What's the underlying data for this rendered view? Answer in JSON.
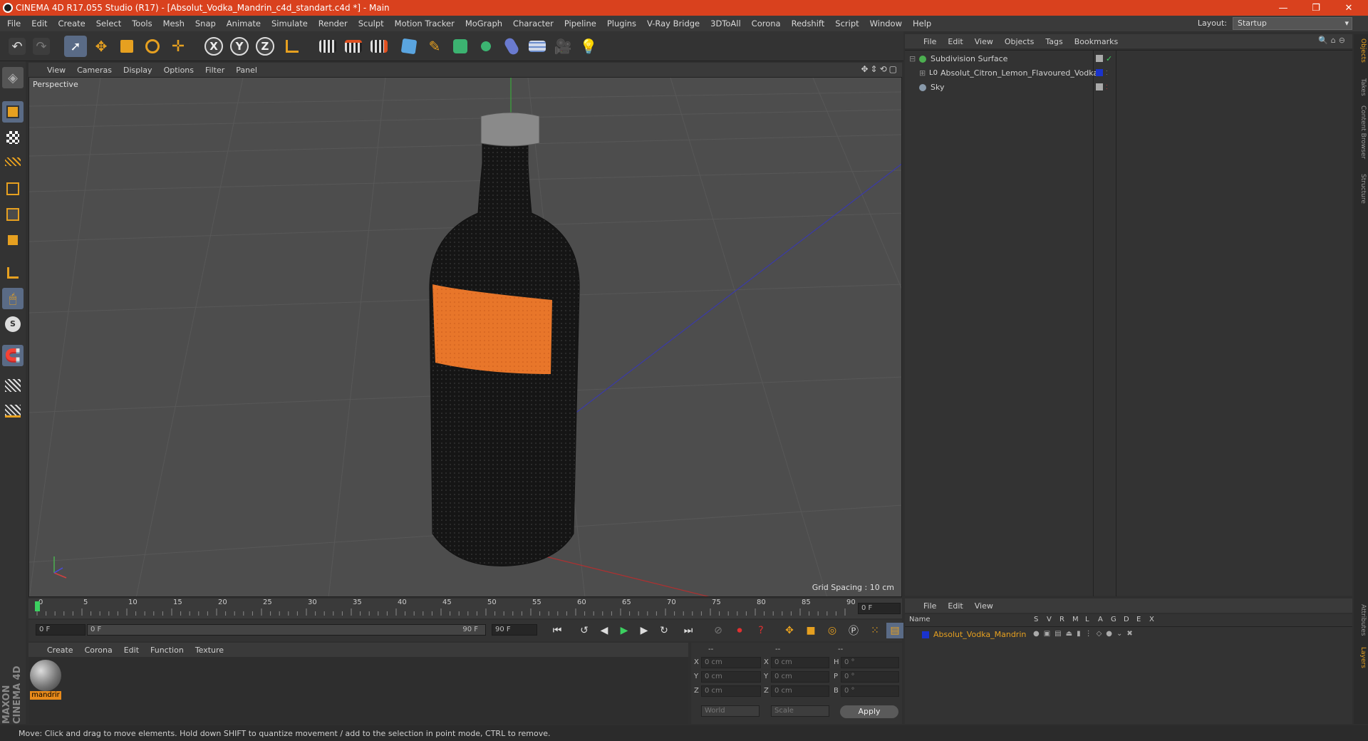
{
  "window": {
    "title": "CINEMA 4D R17.055 Studio (R17) - [Absolut_Vodka_Mandrin_c4d_standart.c4d *] - Main",
    "controls": {
      "minimize": "—",
      "restore": "❐",
      "close": "✕"
    }
  },
  "menubar": {
    "items": [
      "File",
      "Edit",
      "Create",
      "Select",
      "Tools",
      "Mesh",
      "Snap",
      "Animate",
      "Simulate",
      "Render",
      "Sculpt",
      "Motion Tracker",
      "MoGraph",
      "Character",
      "Pipeline",
      "Plugins",
      "V-Ray Bridge",
      "3DToAll",
      "Corona",
      "Redshift",
      "Script",
      "Window",
      "Help"
    ],
    "layout_label": "Layout:",
    "layout_value": "Startup"
  },
  "toolbar": {
    "axis_x": "X",
    "axis_y": "Y",
    "axis_z": "Z"
  },
  "viewport": {
    "menu": [
      "View",
      "Cameras",
      "Display",
      "Options",
      "Filter",
      "Panel"
    ],
    "label": "Perspective",
    "grid_spacing": "Grid Spacing : 10 cm"
  },
  "timeline": {
    "ticks": [
      "0",
      "5",
      "10",
      "15",
      "20",
      "25",
      "30",
      "35",
      "40",
      "45",
      "50",
      "55",
      "60",
      "65",
      "70",
      "75",
      "80",
      "85",
      "90"
    ],
    "current_frame": "0 F",
    "start_field": "0 F",
    "range_start": "0 F",
    "range_end": "90 F",
    "end_field": "90 F"
  },
  "material_manager": {
    "menu": [
      "Create",
      "Corona",
      "Edit",
      "Function",
      "Texture"
    ],
    "material_name": "mandrir"
  },
  "coordinates": {
    "header": [
      "--",
      "--",
      "--"
    ],
    "rows": [
      {
        "axis": "X",
        "pos": "0 cm",
        "size_axis": "X",
        "size": "0 cm",
        "rot_axis": "H",
        "rot": "0 °"
      },
      {
        "axis": "Y",
        "pos": "0 cm",
        "size_axis": "Y",
        "size": "0 cm",
        "rot_axis": "P",
        "rot": "0 °"
      },
      {
        "axis": "Z",
        "pos": "0 cm",
        "size_axis": "Z",
        "size": "0 cm",
        "rot_axis": "B",
        "rot": "0 °"
      }
    ],
    "space": "World",
    "mode": "Scale",
    "apply": "Apply"
  },
  "object_manager": {
    "menu": [
      "File",
      "Edit",
      "View",
      "Objects",
      "Tags",
      "Bookmarks"
    ],
    "objects": [
      {
        "name": "Subdivision Surface",
        "color": "#4caf50"
      },
      {
        "name": "Absolut_Citron_Lemon_Flavoured_Vodka",
        "color": "#1a33cc"
      },
      {
        "name": "Sky",
        "color": "#8899aa"
      }
    ]
  },
  "layer_manager": {
    "menu": [
      "File",
      "Edit",
      "View"
    ],
    "columns": [
      "Name",
      "S",
      "V",
      "R",
      "M",
      "L",
      "A",
      "G",
      "D",
      "E",
      "X"
    ],
    "layers": [
      {
        "name": "Absolut_Vodka_Mandrin",
        "color": "#1a33cc"
      }
    ]
  },
  "right_tabs": [
    "Objects",
    "Takes",
    "Content Browser",
    "Structure",
    "Attributes",
    "Layers"
  ],
  "status": "Move: Click and drag to move elements. Hold down SHIFT to quantize movement / add to the selection in point mode, CTRL to remove.",
  "brand": "MAXON CINEMA 4D",
  "colors": {
    "accent": "#d9411e",
    "label_orange": "#e8762a",
    "selection_blue": "#5a8fd8"
  }
}
